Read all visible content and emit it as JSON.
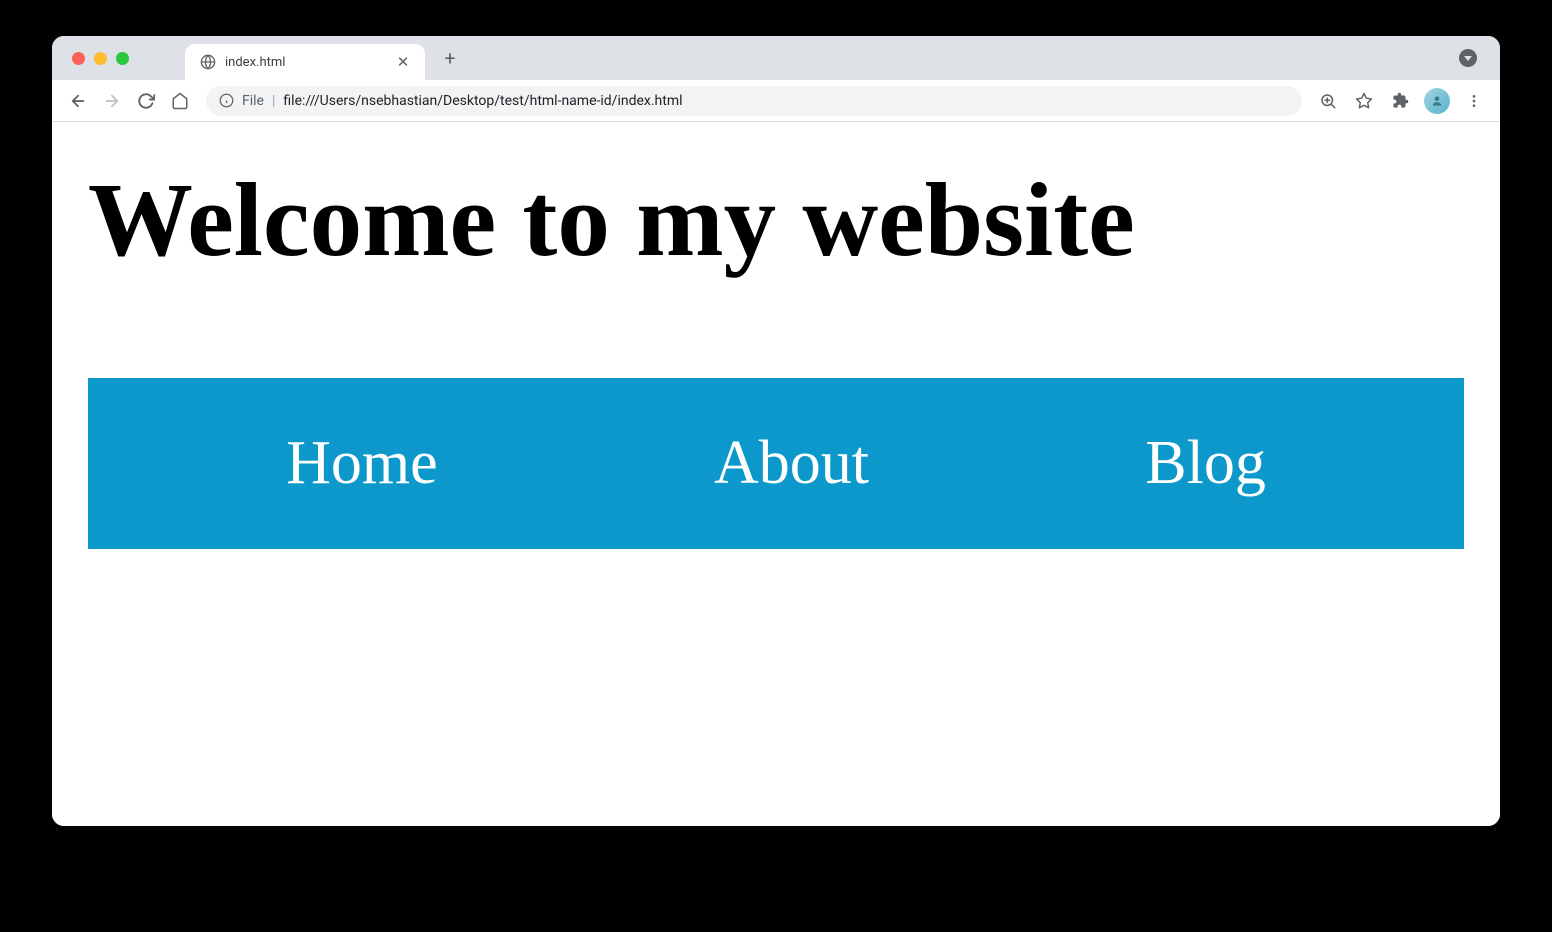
{
  "browser": {
    "tab": {
      "title": "index.html"
    },
    "url": {
      "scheme": "File",
      "path": "file:///Users/nsebhastian/Desktop/test/html-name-id/index.html"
    }
  },
  "page": {
    "heading": "Welcome to my website",
    "nav": {
      "items": [
        {
          "label": "Home"
        },
        {
          "label": "About"
        },
        {
          "label": "Blog"
        }
      ],
      "bg_color": "#0d98cb"
    }
  }
}
